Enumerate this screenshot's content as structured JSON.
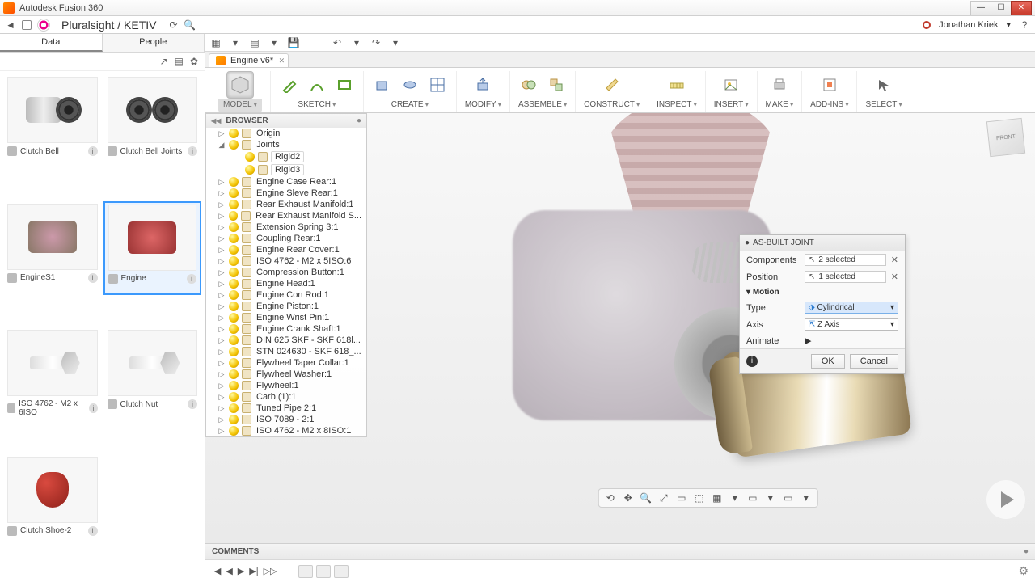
{
  "app": {
    "title": "Autodesk Fusion 360"
  },
  "quick": {
    "back": "◄",
    "home": "⌂",
    "crumb": "Pluralsight / KETIV",
    "refresh": "⟳",
    "search": "🔍",
    "user": "Jonathan Kriek",
    "user_drop": "▾",
    "help": "?"
  },
  "datapanel": {
    "tabs": [
      "Data",
      "People"
    ],
    "tool_icons": [
      "↗",
      "▤",
      "✿"
    ],
    "thumbs": [
      {
        "label": "Clutch Bell"
      },
      {
        "label": "Clutch Bell Joints"
      },
      {
        "label": "EngineS1"
      },
      {
        "label": "Engine",
        "selected": true
      },
      {
        "label": "ISO 4762 - M2 x 6ISO"
      },
      {
        "label": "Clutch Nut"
      },
      {
        "label": "Clutch Shoe-2"
      }
    ]
  },
  "iconrow": [
    "▦",
    "▾",
    "▤",
    "▾",
    "💾",
    "",
    "↶",
    "▾",
    "↷",
    "▾"
  ],
  "doctab": {
    "label": "Engine v6*",
    "close": "✕"
  },
  "ribbon": [
    {
      "label": "MODEL",
      "cls": "model",
      "icons": [
        "cube"
      ]
    },
    {
      "label": "SKETCH",
      "icons": [
        "pencil",
        "arc",
        "rect"
      ]
    },
    {
      "label": "CREATE",
      "icons": [
        "box",
        "rev",
        "grid"
      ]
    },
    {
      "label": "MODIFY",
      "icons": [
        "pull"
      ]
    },
    {
      "label": "ASSEMBLE",
      "icons": [
        "asm",
        "asm2"
      ]
    },
    {
      "label": "CONSTRUCT",
      "icons": [
        "plane"
      ]
    },
    {
      "label": "INSPECT",
      "icons": [
        "measure"
      ]
    },
    {
      "label": "INSERT",
      "icons": [
        "img"
      ]
    },
    {
      "label": "MAKE",
      "icons": [
        "print"
      ]
    },
    {
      "label": "ADD-INS",
      "icons": [
        "addin"
      ]
    },
    {
      "label": "SELECT",
      "icons": [
        "sel"
      ]
    }
  ],
  "browser": {
    "title": "BROWSER",
    "nodes": [
      {
        "d": 1,
        "exp": "▷",
        "label": "Origin",
        "ico": "folder"
      },
      {
        "d": 1,
        "exp": "◢",
        "label": "Joints",
        "ico": "folder"
      },
      {
        "d": 2,
        "exp": "",
        "label": "Rigid2",
        "ico": "joint",
        "box": true
      },
      {
        "d": 2,
        "exp": "",
        "label": "Rigid3",
        "ico": "joint",
        "box": true
      },
      {
        "d": 1,
        "exp": "▷",
        "label": "Engine Case Rear:1"
      },
      {
        "d": 1,
        "exp": "▷",
        "label": "Engine Sleve Rear:1"
      },
      {
        "d": 1,
        "exp": "▷",
        "label": "Rear Exhaust Manifold:1"
      },
      {
        "d": 1,
        "exp": "▷",
        "label": "Rear Exhaust Manifold S..."
      },
      {
        "d": 1,
        "exp": "▷",
        "label": "Extension Spring 3:1"
      },
      {
        "d": 1,
        "exp": "▷",
        "label": "Coupling Rear:1"
      },
      {
        "d": 1,
        "exp": "▷",
        "label": "Engine Rear Cover:1"
      },
      {
        "d": 1,
        "exp": "▷",
        "label": "ISO 4762 - M2 x 5ISO:6"
      },
      {
        "d": 1,
        "exp": "▷",
        "label": "Compression Button:1"
      },
      {
        "d": 1,
        "exp": "▷",
        "label": "Engine Head:1"
      },
      {
        "d": 1,
        "exp": "▷",
        "label": "Engine Con Rod:1"
      },
      {
        "d": 1,
        "exp": "▷",
        "label": "Engine Piston:1"
      },
      {
        "d": 1,
        "exp": "▷",
        "label": "Engine Wrist Pin:1"
      },
      {
        "d": 1,
        "exp": "▷",
        "label": "Engine Crank Shaft:1"
      },
      {
        "d": 1,
        "exp": "▷",
        "label": "DIN 625 SKF - SKF 618l..."
      },
      {
        "d": 1,
        "exp": "▷",
        "label": "STN 024630 - SKF 618_..."
      },
      {
        "d": 1,
        "exp": "▷",
        "label": "Flywheel Taper Collar:1"
      },
      {
        "d": 1,
        "exp": "▷",
        "label": "Flywheel Washer:1"
      },
      {
        "d": 1,
        "exp": "▷",
        "label": "Flywheel:1"
      },
      {
        "d": 1,
        "exp": "▷",
        "label": "Carb (1):1"
      },
      {
        "d": 1,
        "exp": "▷",
        "label": "Tuned Pipe 2:1"
      },
      {
        "d": 1,
        "exp": "▷",
        "label": "ISO 7089 - 2:1"
      },
      {
        "d": 1,
        "exp": "▷",
        "label": "ISO 4762 - M2 x 8ISO:1"
      }
    ]
  },
  "panel": {
    "title": "AS-BUILT JOINT",
    "components_label": "Components",
    "components_value": "2 selected",
    "position_label": "Position",
    "position_value": "1 selected",
    "motion_label": "Motion",
    "type_label": "Type",
    "type_value": "Cylindrical",
    "axis_label": "Axis",
    "axis_value": "Z Axis",
    "animate_label": "Animate",
    "animate_value": "▶",
    "ok": "OK",
    "cancel": "Cancel",
    "clear": "✕"
  },
  "comments": {
    "label": "COMMENTS"
  },
  "timeline": {
    "btns": [
      "|◀",
      "◀",
      "▶",
      "▶|",
      "▷▷"
    ]
  },
  "viewcube": "FRONT",
  "navicons": [
    "⟲",
    "✥",
    "🔍",
    "⤢",
    "▭",
    "⬚",
    "▦",
    "▾",
    "▭",
    "▾",
    "▭",
    "▾"
  ]
}
